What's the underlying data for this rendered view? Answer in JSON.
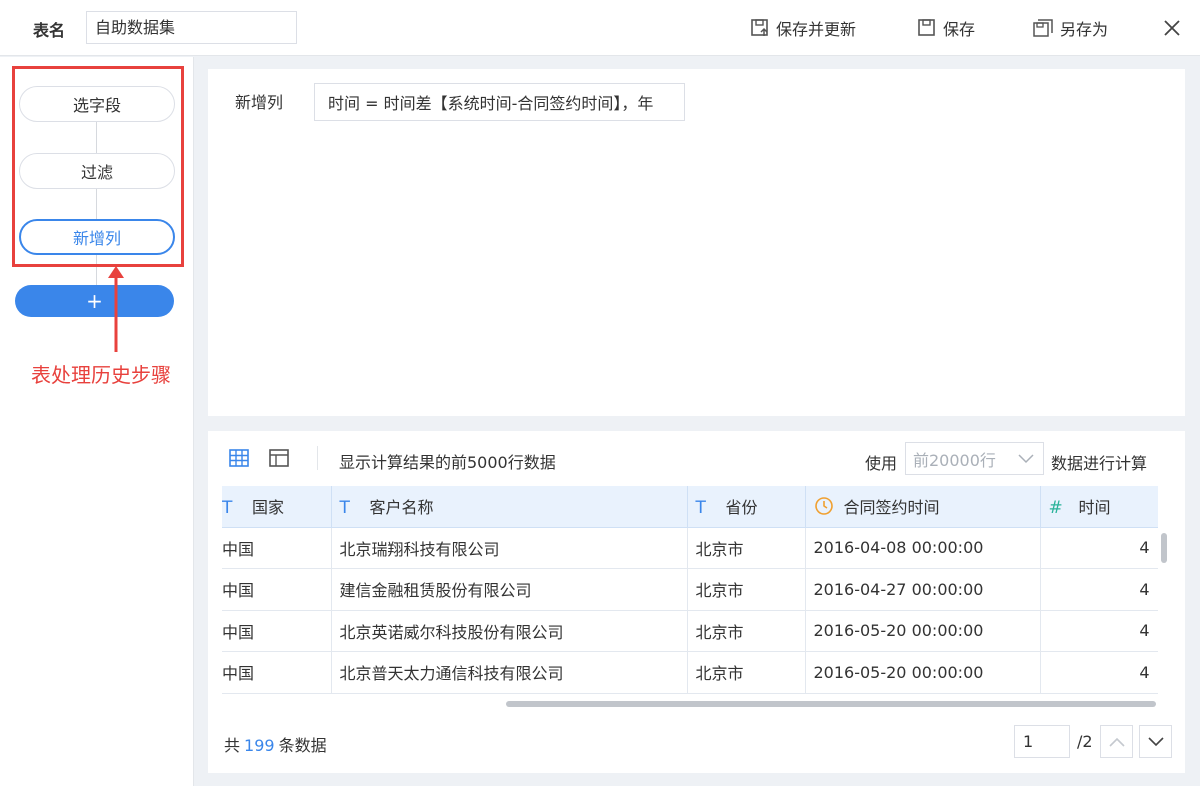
{
  "topbar": {
    "table_name_label": "表名",
    "table_name_value": "自助数据集",
    "save_update_label": "保存并更新",
    "save_label": "保存",
    "save_as_label": "另存为"
  },
  "steps": {
    "items": [
      {
        "label": "选字段"
      },
      {
        "label": "过滤"
      },
      {
        "label": "新增列"
      }
    ],
    "add_label": "+",
    "annotation": "表处理历史步骤"
  },
  "formula": {
    "label": "新增列",
    "value": "时间 = 时间差【系统时间-合同签约时间】，年"
  },
  "data_panel": {
    "info": "显示计算结果的前5000行数据",
    "use_label": "使用",
    "row_select_value": "前20000行",
    "calc_label": "数据进行计算",
    "columns": [
      {
        "type_icon": "T",
        "label": "国家"
      },
      {
        "type_icon": "T",
        "label": "客户名称"
      },
      {
        "type_icon": "T",
        "label": "省份"
      },
      {
        "type_icon": "clock-icon",
        "label": "合同签约时间"
      },
      {
        "type_icon": "#",
        "label": "时间"
      }
    ],
    "rows": [
      [
        "中国",
        "北京瑞翔科技有限公司",
        "北京市",
        "2016-04-08 00:00:00",
        "4"
      ],
      [
        "中国",
        "建信金融租赁股份有限公司",
        "北京市",
        "2016-04-27 00:00:00",
        "4"
      ],
      [
        "中国",
        "北京英诺威尔科技股份有限公司",
        "北京市",
        "2016-05-20 00:00:00",
        "4"
      ],
      [
        "中国",
        "北京普天太力通信科技有限公司",
        "北京市",
        "2016-05-20 00:00:00",
        "4"
      ]
    ],
    "total_prefix": "共",
    "total_count": "199",
    "total_suffix": "条数据",
    "page_current": "1",
    "page_total": "/2"
  },
  "colors": {
    "accent": "#3a86ea",
    "annotation_red": "#e8413d",
    "header_bg": "#e9f2fd",
    "clock_orange": "#f0a030",
    "number_green": "#2ab39a"
  }
}
